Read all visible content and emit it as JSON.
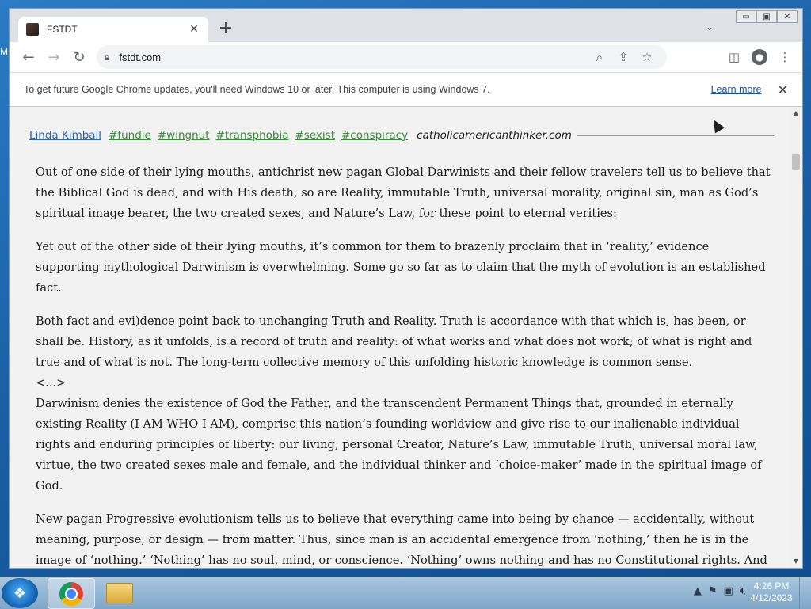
{
  "desktop": {
    "left_edge_text": "M"
  },
  "window": {
    "controls": {
      "minimize": "▭",
      "maximize": "▣",
      "close": "✕"
    },
    "tab": {
      "title": "FSTDT",
      "close_icon": "✕"
    },
    "new_tab_icon": "+",
    "tab_search_icon": "⌄"
  },
  "toolbar": {
    "back_icon": "←",
    "forward_icon": "→",
    "reload_icon": "↻",
    "url": "fstdt.com",
    "lock_icon": "🔒︎",
    "search_icon": "⌕",
    "share_icon": "⇪",
    "bookmark_icon": "☆",
    "sidepanel_icon": "◫",
    "profile_icon": "●",
    "menu_icon": "⋮"
  },
  "infobar": {
    "message": "To get future Google Chrome updates, you'll need Windows 10 or later. This computer is using Windows 7.",
    "learn_more": "Learn more",
    "close_icon": "✕"
  },
  "post": {
    "author": "Linda Kimball",
    "tags": [
      "#fundie",
      "#wingnut",
      "#transphobia",
      "#sexist",
      "#conspiracy"
    ],
    "source": "catholicamericanthinker.com",
    "paragraphs": [
      "Out of one side of their lying mouths, antichrist new pagan Global Darwinists and their fellow travelers tell us to believe that the Biblical God is dead, and with His death, so are Reality, immutable Truth, universal morality, original sin, man as God’s spiritual image bearer, the two created sexes, and Nature’s Law, for these point to eternal verities:",
      "Yet out of the other side of their lying mouths, it’s common for them to brazenly proclaim that in ‘reality,’ evidence supporting mythological Darwinism is overwhelming. Some go so far as to claim that the myth of evolution is an established fact.",
      "Both fact and evi)dence point back to unchanging Truth and Reality. Truth is accordance with that which is, has been, or shall be. History, as it unfolds, is a record of truth and reality: of what works and what does not work; of what is right and true and of what is not. The long-term collective memory of this unfolding historic knowledge is common sense.",
      "<...>",
      "Darwinism denies the existence of God the Father, and the transcendent Permanent Things that, grounded in eternally existing Reality (I AM WHO I AM), comprise this nation’s founding worldview and give rise to our inalienable individual rights and enduring principles of liberty: our living, personal Creator, Nature’s Law, immutable Truth, universal moral law, virtue, the two created sexes male and female, and the individual thinker and ‘choice-maker’ made in the spiritual image of God.",
      "New pagan Progressive evolutionism tells us to believe that everything came into being by chance — accidentally, without meaning, purpose, or design — from matter. Thus, since man is an accidental emergence from ‘nothing,’ then he is in the image of ‘nothing.’ ‘Nothing’ has no soul, mind, or conscience. ‘Nothing’ owns nothing and has no Constitutional rights. And since ‘nothing’ is neither male nor female, then neither should man be, rather man ought to be ‘gender fluid,’ a term for polymorphously perverse androgyne or transgender."
    ]
  },
  "taskbar": {
    "start_icon": "❖",
    "tray_icons": [
      "▲",
      "⚑",
      "▣",
      "🔇︎"
    ],
    "time": "4:26 PM",
    "date": "4/12/2023"
  }
}
